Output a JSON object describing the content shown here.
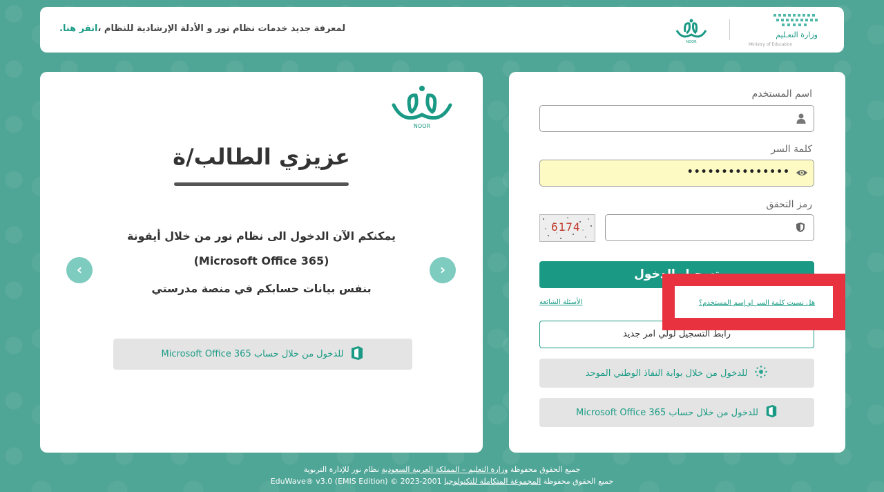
{
  "header": {
    "notice_text": "لمعرفة جديد خدمات نظام نور و الأدلة الإرشادية للنظام ،",
    "notice_link": "انقر هنا.",
    "moe_logo_ar": "وزارة التعـليم",
    "moe_logo_en": "Ministry of Education",
    "noor_logo_small": "NOOR"
  },
  "left_panel": {
    "logo_text": "NOOR",
    "greeting": "عزيزي الطالب/ة",
    "message_line1": "يمكنكم الآن الدخول الى نظام نور من خلال أيقونة",
    "message_line2": "(Microsoft Office 365)",
    "message_line3": "بنفس بيانات حسابكم في منصة مدرستي",
    "prev_arrow": "‹",
    "next_arrow": "›",
    "office_button_label": "للدخول من خلال حساب Microsoft Office 365"
  },
  "login_form": {
    "username_label": "اسم المستخدم",
    "username_value": "",
    "password_label": "كلمة السر",
    "password_masked": "•••••••••••••••",
    "captcha_label": "رمز التحقق",
    "captcha_value": "",
    "captcha_image_text": "6174",
    "login_button": "تسجيل الدخول",
    "faq_link": "الأسئلة الشائعة",
    "forgot_link": "هل نسيت كلمة السر او إسم المستخدم؟",
    "register_button": "رابط التسجيل لولي امر جديد",
    "nafath_button": "للدخول من خلال بوابة النفاذ الوطني الموحد",
    "office_button": "للدخول من خلال حساب Microsoft Office 365"
  },
  "footer": {
    "line1_prefix": "جميع الحقوق محفوظة",
    "line1_link": "وزارة التعليم – المملكة العربية السعودية",
    "line1_suffix": "نظام نور للإدارة التربوية",
    "line2_prefix": "جميع الحقوق محفوظة",
    "line2_link": "المجموعة المتكاملة للتكنولوجيا",
    "line2_suffix": "2001-2023 © EduWave® v3.0 (EMIS Edition)"
  },
  "colors": {
    "background": "#4fa596",
    "accent": "#1a9984",
    "highlight": "#e8323f",
    "autofill": "#fdfbc3"
  }
}
